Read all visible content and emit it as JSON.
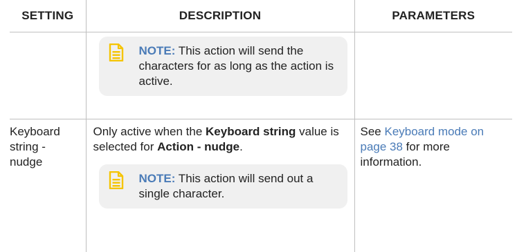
{
  "table": {
    "headers": {
      "setting": "SETTING",
      "description": "DESCRIPTION",
      "parameters": "PARAMETERS"
    },
    "rows": [
      {
        "setting": "",
        "description_text": "",
        "note": {
          "label": "NOTE:",
          "text": " This action will send the characters for as long as the action is active."
        },
        "parameters": ""
      },
      {
        "setting": "Keyboard string - nudge",
        "description": {
          "part1": "Only active when the ",
          "bold1": "Keyboard string",
          "part2": " value is selected for ",
          "bold2": "Action - nudge",
          "part3": "."
        },
        "note": {
          "label": "NOTE:",
          "text": " This action will send out a single character."
        },
        "parameters": {
          "prefix": "See ",
          "link_text": "Keyboard mode on page 38",
          "suffix": "  for more information."
        }
      }
    ]
  },
  "colors": {
    "note_icon": "#f5c400",
    "note_label": "#4a7bb7",
    "link": "#4a7bb7",
    "note_background": "#f0f0f0",
    "border": "#bfbfbf"
  },
  "icons": {
    "note": "note-document-icon"
  }
}
